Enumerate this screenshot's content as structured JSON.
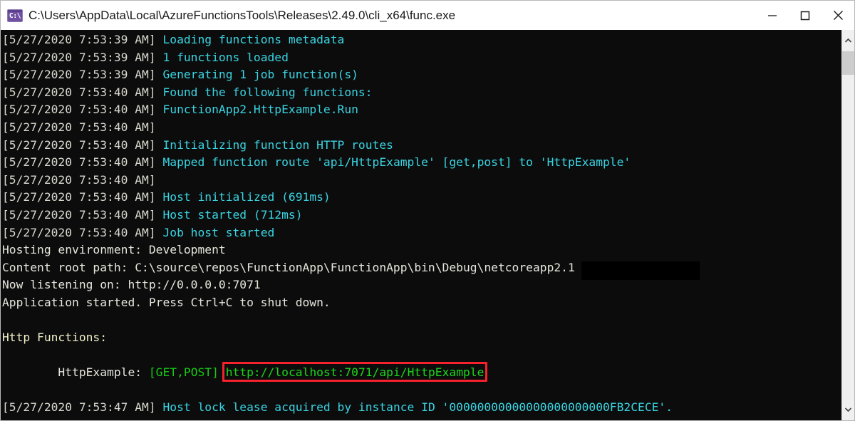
{
  "window": {
    "title": "C:\\Users\\AppData\\Local\\AzureFunctionsTools\\Releases\\2.49.0\\cli_x64\\func.exe",
    "icon": "console-app-icon",
    "icon_glyph": "C:\\",
    "controls": {
      "minimize": "minimize-button",
      "maximize": "maximize-button",
      "close": "close-button"
    }
  },
  "console": {
    "background": "#0c0c0c",
    "colors": {
      "timestamp": "#d8d8cf",
      "message": "#3ad4e2",
      "plain": "#e6e6dd",
      "heading": "#f2f0c8",
      "url": "#1bd81b",
      "highlight_box": "#f5212d"
    },
    "lines": [
      {
        "timestamp": "[5/27/2020 7:53:39 AM]",
        "message": "Loading functions metadata"
      },
      {
        "timestamp": "[5/27/2020 7:53:39 AM]",
        "message": "1 functions loaded"
      },
      {
        "timestamp": "[5/27/2020 7:53:39 AM]",
        "message": "Generating 1 job function(s)"
      },
      {
        "timestamp": "[5/27/2020 7:53:40 AM]",
        "message": "Found the following functions:"
      },
      {
        "timestamp": "[5/27/2020 7:53:40 AM]",
        "message": "FunctionApp2.HttpExample.Run"
      },
      {
        "timestamp": "[5/27/2020 7:53:40 AM]",
        "message": ""
      },
      {
        "timestamp": "[5/27/2020 7:53:40 AM]",
        "message": "Initializing function HTTP routes"
      },
      {
        "timestamp": "[5/27/2020 7:53:40 AM]",
        "message": "Mapped function route 'api/HttpExample' [get,post] to 'HttpExample'"
      },
      {
        "timestamp": "[5/27/2020 7:53:40 AM]",
        "message": ""
      },
      {
        "timestamp": "[5/27/2020 7:53:40 AM]",
        "message": "Host initialized (691ms)"
      },
      {
        "timestamp": "[5/27/2020 7:53:40 AM]",
        "message": "Host started (712ms)"
      },
      {
        "timestamp": "[5/27/2020 7:53:40 AM]",
        "message": "Job host started"
      }
    ],
    "plain_lines": [
      "Hosting environment: Development",
      "Content root path: C:\\source\\repos\\FunctionApp\\FunctionApp\\bin\\Debug\\netcoreapp2.1",
      "Now listening on: http://0.0.0.0:7071",
      "Application started. Press Ctrl+C to shut down."
    ],
    "http_functions_heading": "Http Functions:",
    "function_entry": {
      "indent": "        ",
      "name": "HttpExample:",
      "methods": "[GET,POST]",
      "url": "http://localhost:7071/api/HttpExample"
    },
    "last_line": {
      "timestamp": "[5/27/2020 7:53:47 AM]",
      "message": "Host lock lease acquired by instance ID '00000000000000000000000FB2CECE'."
    }
  },
  "scrollbar": {
    "up_arrow": "chevron-up-icon",
    "down_arrow": "chevron-down-icon",
    "thumb": "scrollbar-thumb"
  }
}
